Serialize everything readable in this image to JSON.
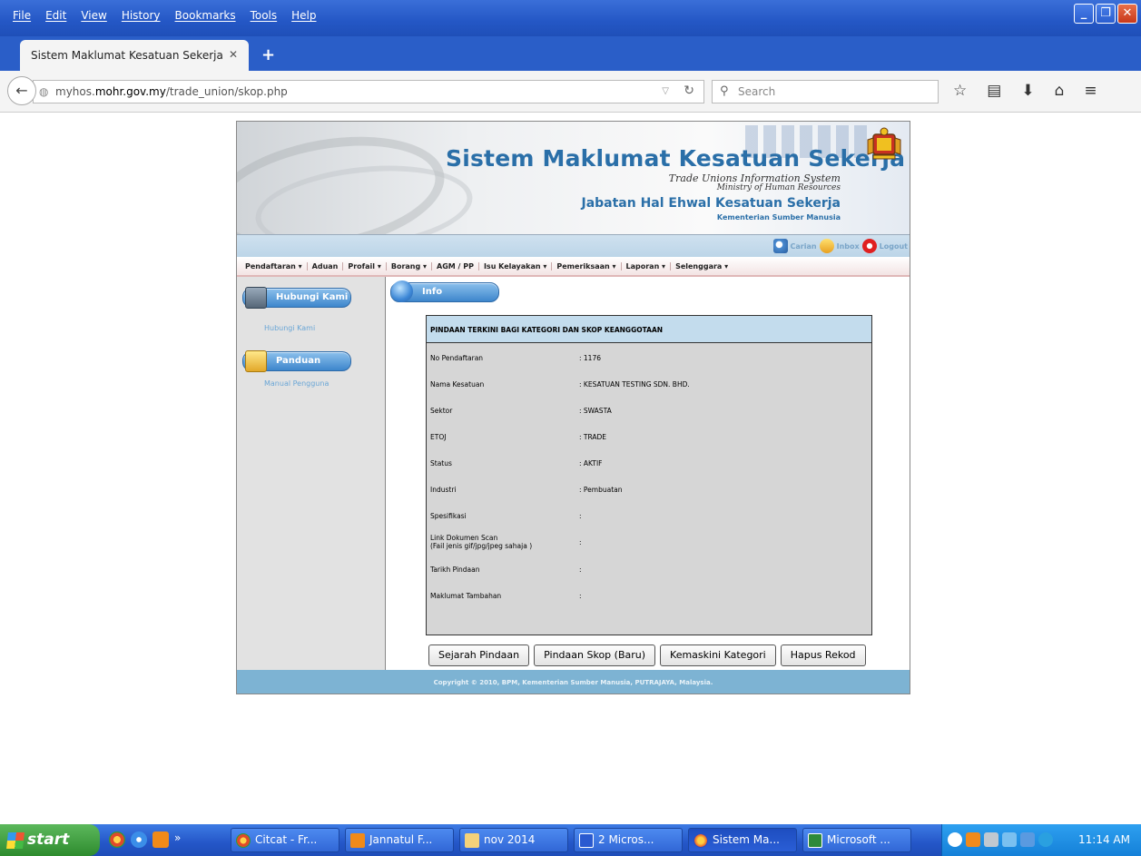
{
  "browser": {
    "menu": [
      "File",
      "Edit",
      "View",
      "History",
      "Bookmarks",
      "Tools",
      "Help"
    ],
    "tab_title": "Sistem Maklumat Kesatuan Sekerja",
    "tab_close": "✕",
    "new_tab": "+",
    "url_prefix": "myhos.",
    "url_host": "mohr.gov.my",
    "url_path": "/trade_union/skop.php",
    "search_placeholder": "Search"
  },
  "banner": {
    "title": "Sistem Maklumat Kesatuan Sekerja",
    "subtitle_1": "Trade Unions Information System",
    "subtitle_2": "Ministry of Human Resources",
    "department": "Jabatan Hal Ehwal Kesatuan Sekerja",
    "ministry": "Kementerian Sumber Manusia"
  },
  "userbar": {
    "search": "Carian",
    "inbox": "Inbox",
    "logout": "Logout"
  },
  "nav": [
    "Pendaftaran ▾",
    "Aduan",
    "Profail ▾",
    "Borang ▾",
    "AGM / PP",
    "Isu Kelayakan ▾",
    "Pemeriksaan ▾",
    "Laporan ▾",
    "Selenggara ▾"
  ],
  "sidebar": {
    "contact_head": "Hubungi Kami",
    "contact_link": "Hubungi Kami",
    "guide_head": "Panduan",
    "guide_link": "Manual Pengguna"
  },
  "content": {
    "tab": "Info",
    "panel_title": "PINDAAN TERKINI BAGI KATEGORI DAN SKOP KEANGGOTAAN",
    "rows": [
      {
        "label": "No Pendaftaran",
        "value": ": 1176"
      },
      {
        "label": "Nama Kesatuan",
        "value": ": KESATUAN TESTING SDN. BHD."
      },
      {
        "label": "Sektor",
        "value": ": SWASTA"
      },
      {
        "label": "ETOJ",
        "value": ": TRADE"
      },
      {
        "label": "Status",
        "value": ": AKTIF"
      },
      {
        "label": "Industri",
        "value": ": Pembuatan"
      },
      {
        "label": "Spesifikasi",
        "value": ":"
      },
      {
        "label": "Link Dokumen Scan",
        "label2": "(Fail jenis gif/jpg/jpeg sahaja )",
        "value": ":"
      },
      {
        "label": "Tarikh Pindaan",
        "value": ":"
      },
      {
        "label": "Maklumat Tambahan",
        "value": ":"
      }
    ],
    "buttons": [
      "Sejarah Pindaan",
      "Pindaan Skop (Baru)",
      "Kemaskini Kategori",
      "Hapus Rekod"
    ]
  },
  "footer": "Copyright © 2010, BPM, Kementerian Sumber Manusia, PUTRAJAYA, Malaysia.",
  "taskbar": {
    "start": "start",
    "chevron": "»",
    "buttons": [
      "Citcat - Fr...",
      "Jannatul F...",
      "nov 2014",
      "2 Micros...",
      "Sistem Ma...",
      "Microsoft ..."
    ],
    "clock": "11:14 AM"
  }
}
